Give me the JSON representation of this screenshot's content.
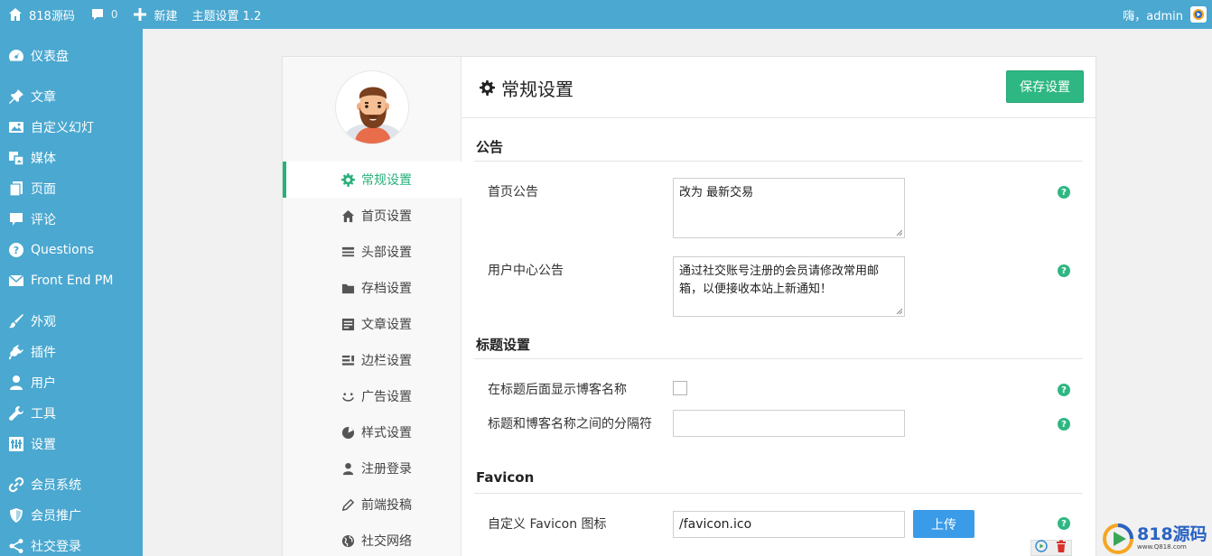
{
  "adminbar": {
    "site_name": "818源码",
    "comments_count": "0",
    "new_label": "新建",
    "theme_settings_label": "主题设置 1.2",
    "greeting": "嗨，admin"
  },
  "sidebar": {
    "items": [
      {
        "label": "仪表盘",
        "icon": "dashboard-icon"
      },
      {
        "label": "文章",
        "icon": "pin-icon"
      },
      {
        "label": "自定义幻灯",
        "icon": "slides-icon"
      },
      {
        "label": "媒体",
        "icon": "media-icon"
      },
      {
        "label": "页面",
        "icon": "page-icon"
      },
      {
        "label": "评论",
        "icon": "comment-icon"
      },
      {
        "label": "Questions",
        "icon": "question-icon"
      },
      {
        "label": "Front End PM",
        "icon": "mail-icon"
      },
      {
        "label": "外观",
        "icon": "brush-icon"
      },
      {
        "label": "插件",
        "icon": "plugin-icon"
      },
      {
        "label": "用户",
        "icon": "user-icon"
      },
      {
        "label": "工具",
        "icon": "wrench-icon"
      },
      {
        "label": "设置",
        "icon": "settings-icon"
      },
      {
        "label": "会员系统",
        "icon": "link-icon"
      },
      {
        "label": "会员推广",
        "icon": "shield-icon"
      },
      {
        "label": "社交登录",
        "icon": "share-icon"
      }
    ]
  },
  "settings_nav": {
    "items": [
      {
        "label": "常规设置",
        "icon": "gear-icon",
        "active": true
      },
      {
        "label": "首页设置",
        "icon": "home-icon"
      },
      {
        "label": "头部设置",
        "icon": "header-icon"
      },
      {
        "label": "存档设置",
        "icon": "folder-icon"
      },
      {
        "label": "文章设置",
        "icon": "article-icon"
      },
      {
        "label": "边栏设置",
        "icon": "sidebar-icon"
      },
      {
        "label": "广告设置",
        "icon": "smile-icon"
      },
      {
        "label": "样式设置",
        "icon": "palette-icon"
      },
      {
        "label": "注册登录",
        "icon": "user-icon"
      },
      {
        "label": "前端投稿",
        "icon": "pencil-icon"
      },
      {
        "label": "社交网络",
        "icon": "globe-icon"
      }
    ]
  },
  "main": {
    "title": "常规设置",
    "save_label": "保存设置",
    "sections": {
      "announcement": {
        "title": "公告",
        "home_label": "首页公告",
        "home_value": "改为 最新交易",
        "user_center_label": "用户中心公告",
        "user_center_value": "通过社交账号注册的会员请修改常用邮箱，以便接收本站上新通知！"
      },
      "title_settings": {
        "title": "标题设置",
        "show_blog_name_label": "在标题后面显示博客名称",
        "separator_label": "标题和博客名称之间的分隔符",
        "separator_value": ""
      },
      "favicon": {
        "title": "Favicon",
        "custom_label": "自定义 Favicon 图标",
        "value": "/favicon.ico",
        "upload_label": "上传"
      }
    },
    "help_symbol": "?"
  },
  "watermark": {
    "brand": "818源码",
    "url": "www.Q818.com"
  },
  "colors": {
    "sidebar": "#4ba8d0",
    "accent_green": "#2fb783",
    "upload_blue": "#3a9be8"
  }
}
